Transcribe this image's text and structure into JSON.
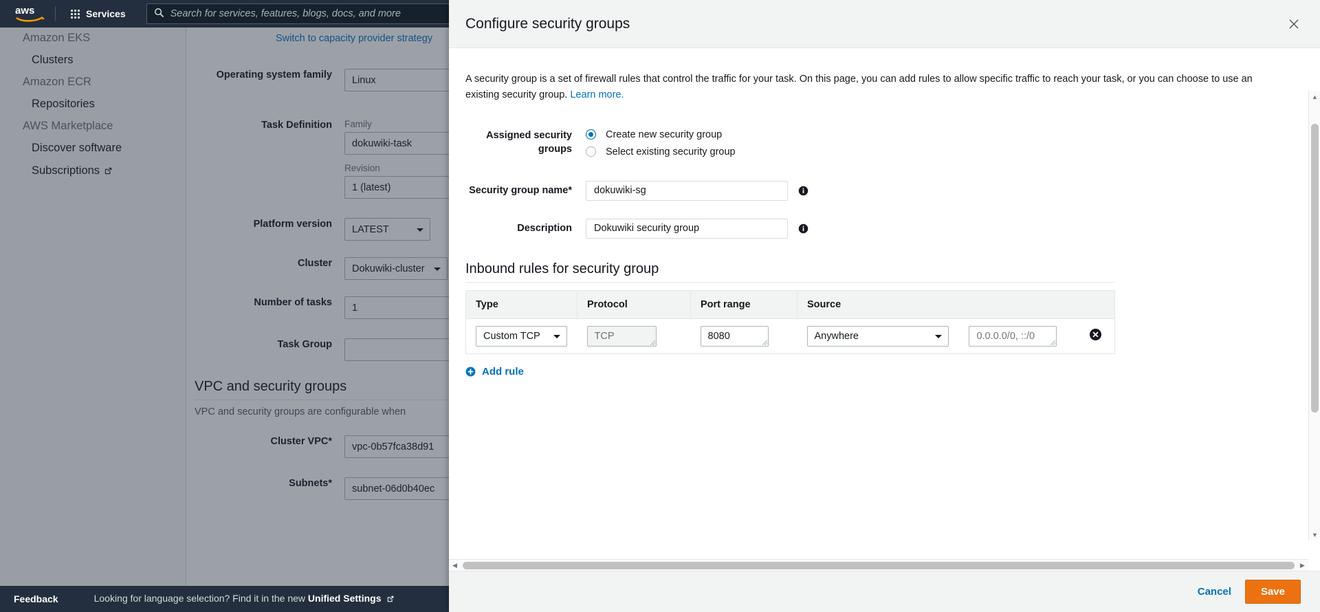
{
  "topnav": {
    "logo_alt": "aws",
    "services_label": "Services",
    "search_placeholder": "Search for services, features, blogs, docs, and more",
    "search_value": ""
  },
  "sidebar": {
    "items": [
      {
        "label": "Amazon EKS",
        "type": "group"
      },
      {
        "label": "Clusters",
        "type": "item"
      },
      {
        "label": "Amazon ECR",
        "type": "group"
      },
      {
        "label": "Repositories",
        "type": "item"
      },
      {
        "label": "AWS Marketplace",
        "type": "group"
      },
      {
        "label": "Discover software",
        "type": "item"
      },
      {
        "label": "Subscriptions",
        "type": "item",
        "external": true
      }
    ]
  },
  "form": {
    "switch_link": "Switch to capacity provider strategy",
    "os_family": {
      "label": "Operating system family",
      "value": "Linux"
    },
    "task_definition": {
      "label": "Task Definition",
      "family_sublabel": "Family",
      "family_value": "dokuwiki-task",
      "revision_sublabel": "Revision",
      "revision_value": "1 (latest)"
    },
    "platform_version": {
      "label": "Platform version",
      "value": "LATEST"
    },
    "cluster": {
      "label": "Cluster",
      "value": "Dokuwiki-cluster"
    },
    "number_of_tasks": {
      "label": "Number of tasks",
      "value": "1"
    },
    "task_group": {
      "label": "Task Group",
      "value": ""
    },
    "vpc_section": {
      "title": "VPC and security groups",
      "description": "VPC and security groups are configurable when"
    },
    "cluster_vpc": {
      "label": "Cluster VPC*",
      "value": "vpc-0b57fca38d91"
    },
    "subnets": {
      "label": "Subnets*",
      "value": "subnet-06d0b40ec"
    }
  },
  "footer": {
    "feedback": "Feedback",
    "note_prefix": "Looking for language selection? Find it in the new",
    "note_link": "Unified Settings"
  },
  "modal": {
    "title": "Configure security groups",
    "close_icon": "close-icon",
    "intro_text": "A security group is a set of firewall rules that control the traffic for your task. On this page, you can add rules to allow specific traffic to reach your task, or you can choose to use an existing security group.",
    "intro_link": "Learn more.",
    "assigned_label": "Assigned security groups",
    "radios": [
      {
        "label": "Create new security group",
        "selected": true
      },
      {
        "label": "Select existing security group",
        "selected": false
      }
    ],
    "sg_name": {
      "label": "Security group name*",
      "value": "dokuwiki-sg",
      "placeholder": ""
    },
    "description": {
      "label": "Description",
      "value": "Dokuwiki security group",
      "placeholder": ""
    },
    "rules_title": "Inbound rules for security group",
    "table": {
      "columns": [
        "Type",
        "Protocol",
        "Port range",
        "Source"
      ],
      "rows": [
        {
          "type": "Custom TCP",
          "protocol": "TCP",
          "port_range": "8080",
          "source": "Anywhere",
          "cidr_placeholder": "0.0.0.0/0, ::/0",
          "cidr_value": ""
        }
      ]
    },
    "add_rule_label": "Add rule",
    "cancel_label": "Cancel",
    "save_label": "Save"
  },
  "colors": {
    "aws_navy": "#232f3e",
    "link_blue": "#0073bb",
    "save_orange": "#ec7211",
    "radio_blue": "#0073bb"
  }
}
